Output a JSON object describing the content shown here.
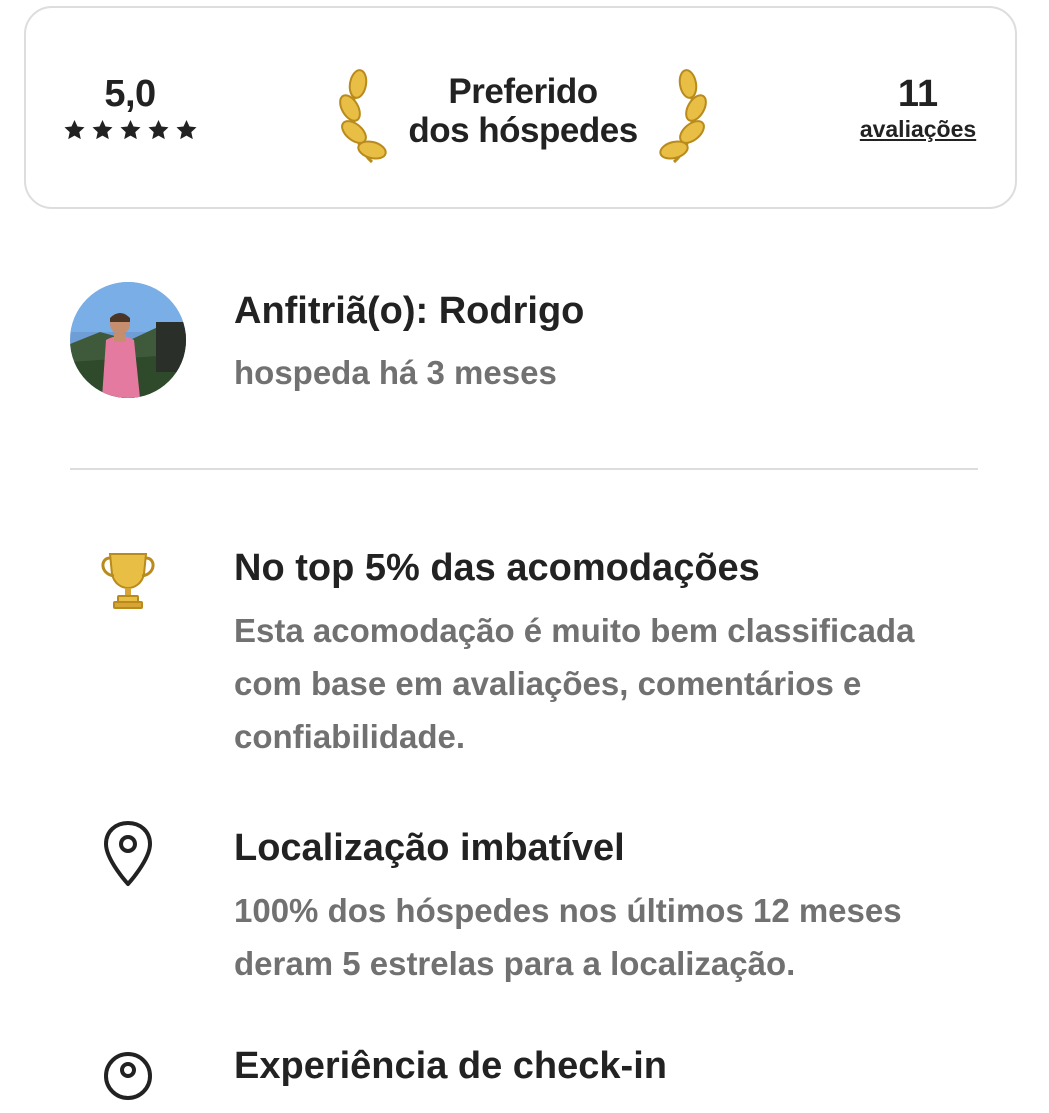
{
  "rating_card": {
    "rating_value": "5,0",
    "stars_count": 5,
    "favorite_line1": "Preferido",
    "favorite_line2": "dos hóspedes",
    "reviews_count": "11",
    "reviews_label": "avaliações"
  },
  "host": {
    "name": "Anfitriã(o): Rodrigo",
    "since": "hospeda há 3 meses"
  },
  "highlights": [
    {
      "icon": "trophy-icon",
      "title": "No top 5% das acomodações",
      "description": "Esta acomodação é muito bem classificada com base em avaliações, comentários e confiabilidade."
    },
    {
      "icon": "location-pin-icon",
      "title": "Localização imbatível",
      "description": "100% dos hóspedes nos últimos 12 meses deram 5 estrelas para a localização."
    },
    {
      "icon": "checkin-icon",
      "title": "Experiência de check-in"
    }
  ],
  "colors": {
    "text_primary": "#222222",
    "text_secondary": "#717171",
    "border": "#dddddd",
    "gold": "#e0b33a"
  }
}
